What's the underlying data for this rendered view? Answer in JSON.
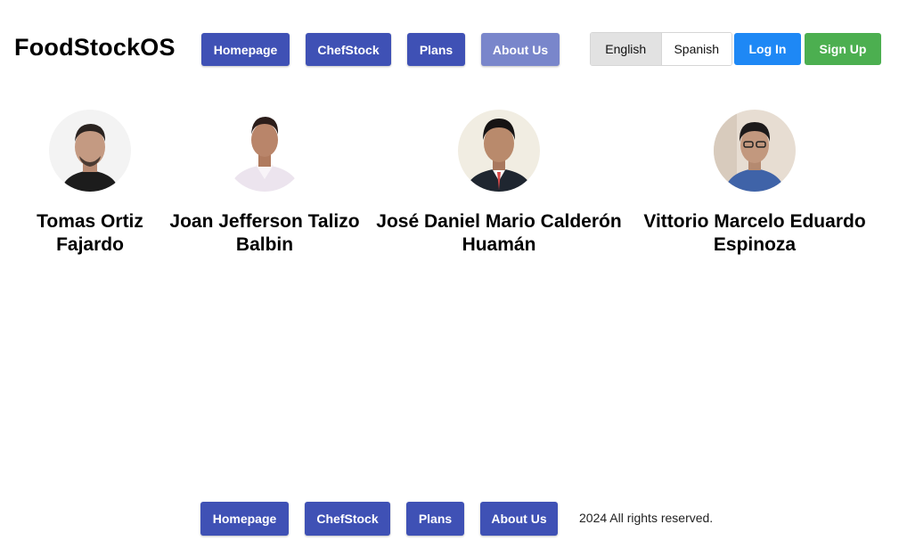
{
  "header": {
    "logo": "FoodStockOS",
    "nav": [
      {
        "label": "Homepage"
      },
      {
        "label": "ChefStock"
      },
      {
        "label": "Plans"
      },
      {
        "label": "About Us"
      }
    ],
    "languages": {
      "selected": "English",
      "other": "Spanish"
    },
    "login_label": "Log In",
    "signup_label": "Sign Up"
  },
  "team": [
    {
      "name_line1": "Tomas Ortiz",
      "name_line2": "Fajardo"
    },
    {
      "name_line1": "Joan Jefferson Talizo",
      "name_line2": "Balbin"
    },
    {
      "name_line1": "José Daniel Mario Calderón",
      "name_line2": "Huamán"
    },
    {
      "name_line1": "Vittorio Marcelo Eduardo",
      "name_line2": "Espinoza"
    }
  ],
  "footer": {
    "nav": [
      {
        "label": "Homepage"
      },
      {
        "label": "ChefStock"
      },
      {
        "label": "Plans"
      },
      {
        "label": "About Us"
      }
    ],
    "copyright": "2024 All rights reserved."
  },
  "colors": {
    "primary": "#3f51b5",
    "active_nav": "#7986cb",
    "login": "#1e88f5",
    "signup": "#4caf50"
  }
}
